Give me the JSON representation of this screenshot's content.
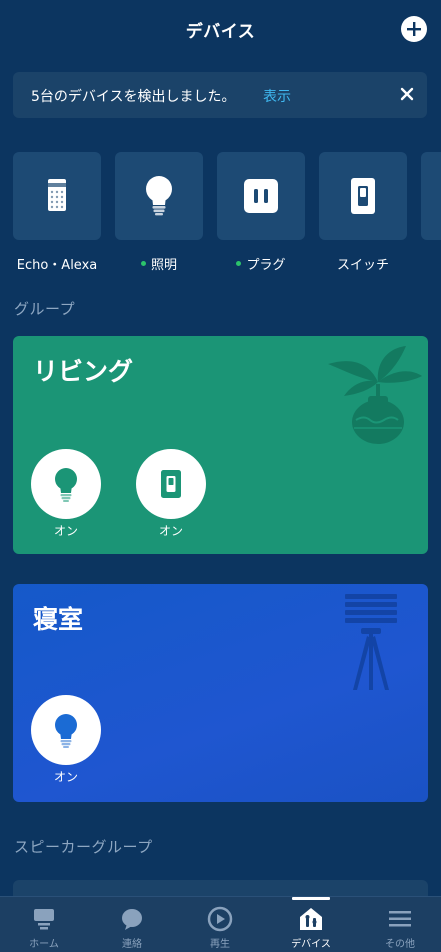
{
  "header": {
    "title": "デバイス",
    "add_icon": "plus-icon"
  },
  "banner": {
    "text": "5台のデバイスを検出しました。",
    "link": "表示",
    "close_icon": "close-icon"
  },
  "categories": [
    {
      "label": "Echo・Alexa",
      "icon": "echo-speaker-icon",
      "dot": false
    },
    {
      "label": "照明",
      "icon": "lightbulb-icon",
      "dot": true
    },
    {
      "label": "プラグ",
      "icon": "plug-icon",
      "dot": true
    },
    {
      "label": "スイッチ",
      "icon": "switch-icon",
      "dot": false
    }
  ],
  "groups_section": {
    "title": "グループ"
  },
  "groups": [
    {
      "name": "リビング",
      "color": "#1b9576",
      "devices": [
        {
          "icon": "lightbulb-icon",
          "state": "オン"
        },
        {
          "icon": "switch-icon",
          "state": "オン"
        }
      ]
    },
    {
      "name": "寝室",
      "color": "#1559c9",
      "devices": [
        {
          "icon": "lightbulb-icon",
          "state": "オン"
        }
      ]
    }
  ],
  "speaker_section": {
    "title": "スピーカーグループ"
  },
  "tabbar": {
    "tabs": [
      {
        "label": "ホーム",
        "icon": "home-icon",
        "active": false
      },
      {
        "label": "連絡",
        "icon": "chat-bubble-icon",
        "active": false
      },
      {
        "label": "再生",
        "icon": "play-icon",
        "active": false
      },
      {
        "label": "デバイス",
        "icon": "devices-icon",
        "active": true
      },
      {
        "label": "その他",
        "icon": "menu-icon",
        "active": false
      }
    ]
  },
  "colors": {
    "background": "#0c3560",
    "tile": "#1d4a74",
    "accent_link": "#3fb7ef",
    "status_dot": "#2cc36b",
    "living_card": "#1b9576",
    "bedroom_card": "#1559c9"
  }
}
